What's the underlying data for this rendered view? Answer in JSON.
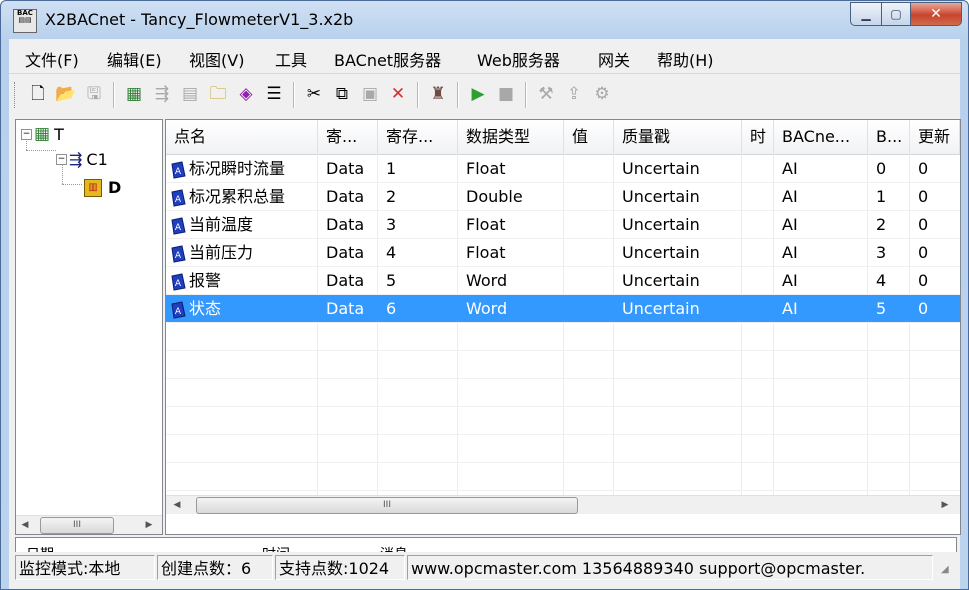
{
  "window": {
    "title": "X2BACnet - Tancy_FlowmeterV1_3.x2b",
    "icon_text": "BAC"
  },
  "menu": [
    "文件(F)",
    "编辑(E)",
    "视图(V)",
    "工具",
    "BACnet服务器",
    "Web服务器",
    "网关",
    "帮助(H)"
  ],
  "toolbar": {
    "icons": [
      "new-file-icon",
      "open-folder-icon",
      "save-icon",
      "add-channel-icon",
      "add-device-icon",
      "device-properties-icon",
      "new-folder-icon",
      "add-point-icon",
      "properties-icon",
      "cut-icon",
      "copy-icon",
      "paste-icon",
      "delete-icon",
      "data-monitor-icon",
      "run-icon",
      "stop-icon",
      "tools-icon",
      "load-icon",
      "wrench-icon"
    ]
  },
  "tree": {
    "root": "T",
    "channel": "C1",
    "device": "D"
  },
  "list": {
    "columns": [
      "点名",
      "寄...",
      "寄存...",
      "数据类型",
      "值",
      "质量戳",
      "时",
      "BACne...",
      "B...",
      "更新"
    ],
    "rows": [
      [
        "标况瞬时流量",
        "Data",
        "1",
        "Float",
        "",
        "Uncertain",
        "",
        "AI",
        "0",
        "0"
      ],
      [
        "标况累积总量",
        "Data",
        "2",
        "Double",
        "",
        "Uncertain",
        "",
        "AI",
        "1",
        "0"
      ],
      [
        "当前温度",
        "Data",
        "3",
        "Float",
        "",
        "Uncertain",
        "",
        "AI",
        "2",
        "0"
      ],
      [
        "当前压力",
        "Data",
        "4",
        "Float",
        "",
        "Uncertain",
        "",
        "AI",
        "3",
        "0"
      ],
      [
        "报警",
        "Data",
        "5",
        "Word",
        "",
        "Uncertain",
        "",
        "AI",
        "4",
        "0"
      ],
      [
        "状态",
        "Data",
        "6",
        "Word",
        "",
        "Uncertain",
        "",
        "AI",
        "5",
        "0"
      ]
    ],
    "selected_row": 5
  },
  "log": {
    "columns": [
      "日期",
      "时间",
      "消息"
    ]
  },
  "scroll": {
    "thumb_text": "III"
  },
  "status": {
    "mode": "监控模式:本地",
    "created": "创建点数：6",
    "supported": "支持点数:1024",
    "contact": "www.opcmaster.com 13564889340 support@opcmaster."
  },
  "colors": {
    "selection": "#3399ff",
    "title_gradient": "#b7d0ec"
  }
}
